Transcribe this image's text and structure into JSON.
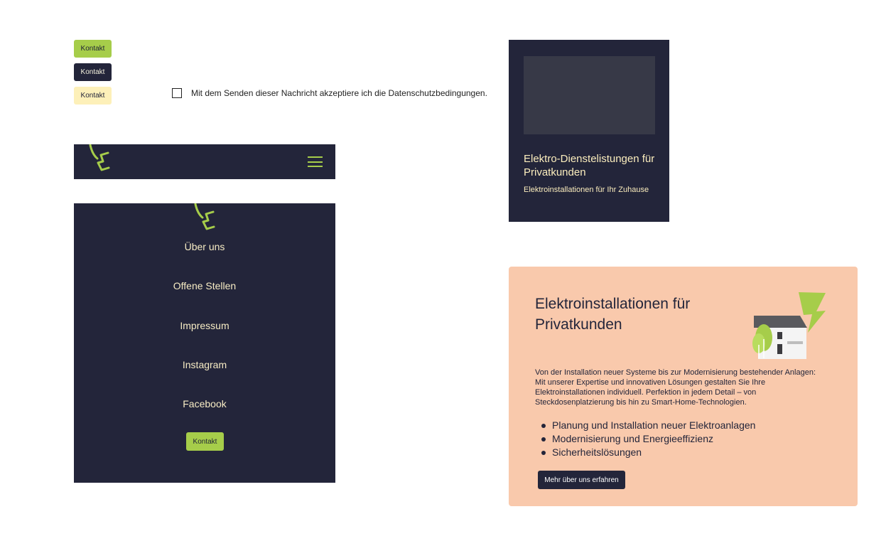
{
  "buttons": {
    "contact_green": "Kontakt",
    "contact_dark": "Kontakt",
    "contact_yellow": "Kontakt"
  },
  "consent": {
    "label": "Mit dem Senden dieser Nachricht akzeptiere ich die Datenschutzbedingungen.",
    "checked": false
  },
  "navbar": {
    "logo_icon": "plug-logo-icon",
    "menu_icon": "hamburger-menu-icon"
  },
  "menu": {
    "logo_icon": "plug-logo-icon",
    "items": [
      {
        "label": "Über uns"
      },
      {
        "label": "Offene Stellen"
      },
      {
        "label": "Impressum"
      },
      {
        "label": "Instagram"
      },
      {
        "label": "Facebook"
      }
    ],
    "contact_label": "Kontakt"
  },
  "card": {
    "title": "Elektro-Dienstelistungen für Privatkunden",
    "subtitle": "Elektroinstallationen für Ihr Zuhause"
  },
  "panel": {
    "heading": "Elektroinstallationen für Privatkunden",
    "paragraph": "Von der Installation neuer Systeme bis zur Modernisierung bestehender Anlagen: Mit unserer Expertise und innovativen Lösungen gestalten Sie Ihre Elektroinstallationen individuell. Perfektion in jedem Detail – von Steckdosenplatzierung bis hin zu Smart-Home-Technologien.",
    "bullets": [
      "Planung und Installation neuer Elektroanlagen",
      "Modernisierung und Energieeffizienz",
      "Sicherheitslösungen"
    ],
    "more_label": "Mehr über uns erfahren",
    "illustration_icon": "house-lightning-illustration"
  },
  "colors": {
    "navy": "#23253a",
    "green": "#a6cd4a",
    "cream": "#fdf0b9",
    "peach": "#f9c9ac",
    "menu_text": "#f7ecc4"
  }
}
